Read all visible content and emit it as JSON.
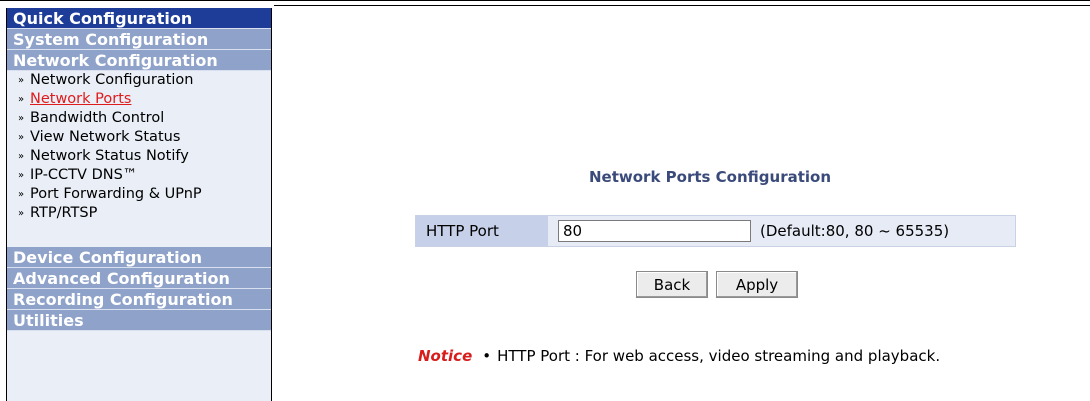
{
  "sidebar": {
    "quick_configuration": "Quick Configuration",
    "system_configuration": "System Configuration",
    "network_configuration": "Network Configuration",
    "network_items": [
      {
        "label": "Network Configuration",
        "current": false
      },
      {
        "label": "Network Ports",
        "current": true
      },
      {
        "label": "Bandwidth Control",
        "current": false
      },
      {
        "label": "View Network Status",
        "current": false
      },
      {
        "label": "Network Status Notify",
        "current": false
      },
      {
        "label": "IP-CCTV DNS™",
        "current": false
      },
      {
        "label": "Port Forwarding & UPnP",
        "current": false
      },
      {
        "label": "RTP/RTSP",
        "current": false
      }
    ],
    "device_configuration": "Device Configuration",
    "advanced_configuration": "Advanced Configuration",
    "recording_configuration": "Recording Configuration",
    "utilities": "Utilities",
    "item_arrow": "»"
  },
  "main": {
    "title": "Network Ports Configuration",
    "http_port_label": "HTTP Port",
    "http_port_value": "80",
    "http_port_hint": "(Default:80, 80 ~ 65535)",
    "back_label": "Back",
    "apply_label": "Apply",
    "notice_label": "Notice",
    "notice_bullet": "•",
    "notice_text": "HTTP Port : For web access, video streaming and playback."
  },
  "colors": {
    "active_menu": "#1d3d99",
    "menu_header": "#8fa2c9",
    "sidebar_bg": "#e9eef7",
    "current_item": "#e01b1b",
    "title": "#3a4a7a",
    "notice": "#d81c1c"
  }
}
